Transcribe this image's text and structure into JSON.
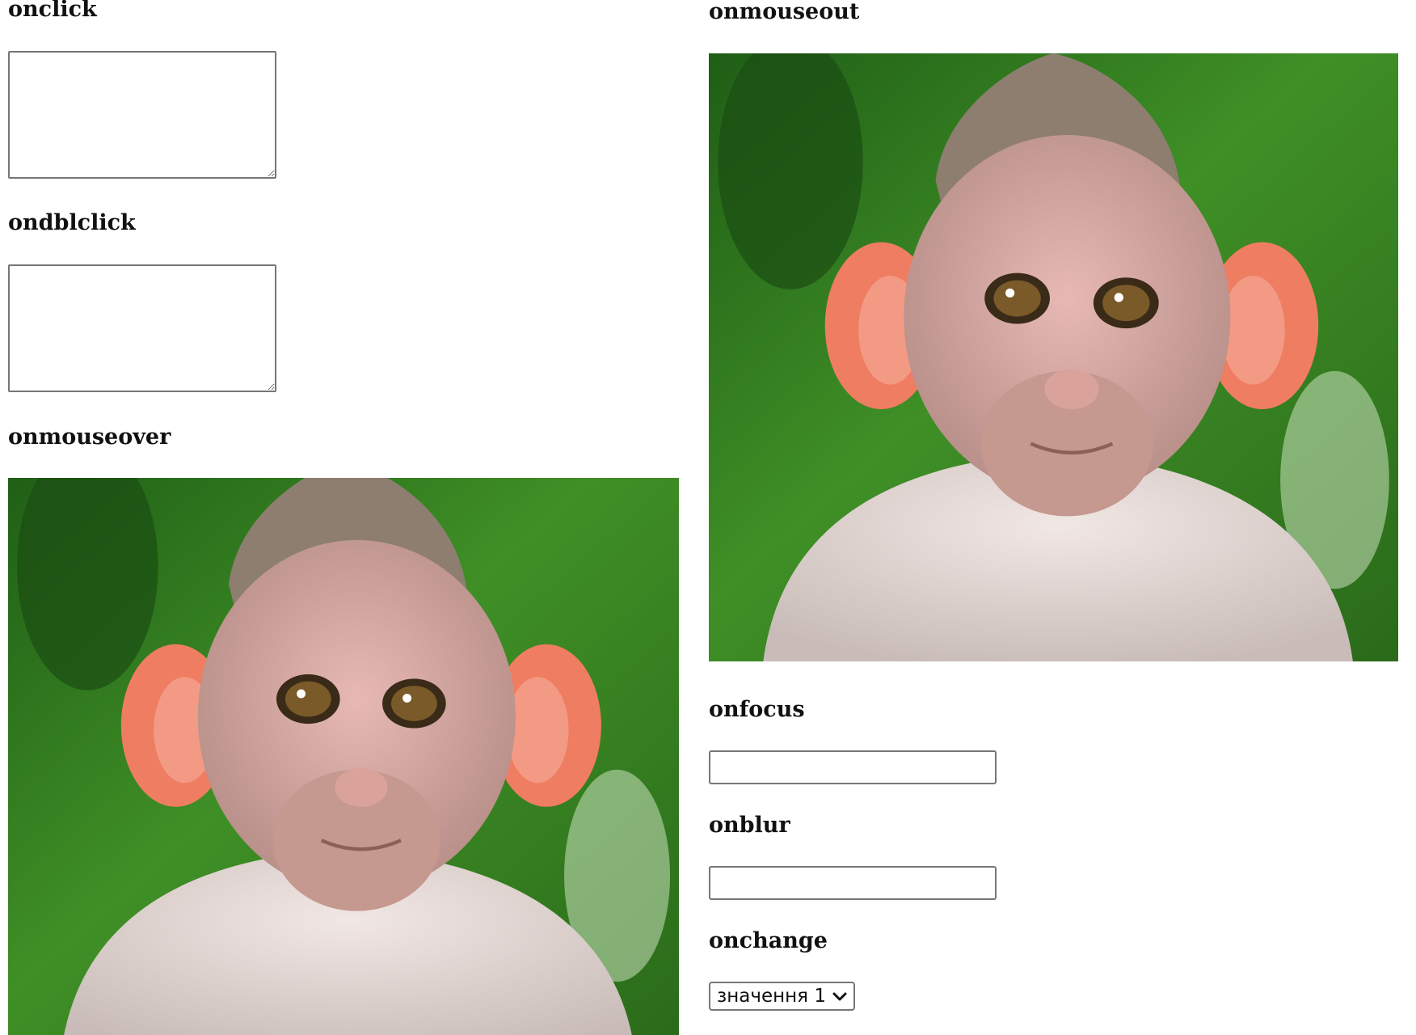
{
  "labels": {
    "onclick": "onclick",
    "ondblclick": "ondblclick",
    "onmouseover": "onmouseover",
    "onmouseout": "onmouseout",
    "onfocus": "onfocus",
    "onblur": "onblur",
    "onchange": "onchange"
  },
  "fields": {
    "onclick_value": "",
    "ondblclick_value": "",
    "onfocus_value": "",
    "onblur_value": ""
  },
  "select": {
    "selected": "значення 1",
    "icon": "chevron-down-icon"
  },
  "images": {
    "subject": "monkey-photo"
  },
  "colors": {
    "text": "#111111",
    "border": "#767676",
    "foliage": "#2f7d1e",
    "fur": "#e2d6d2",
    "ears": "#ef7d62"
  }
}
